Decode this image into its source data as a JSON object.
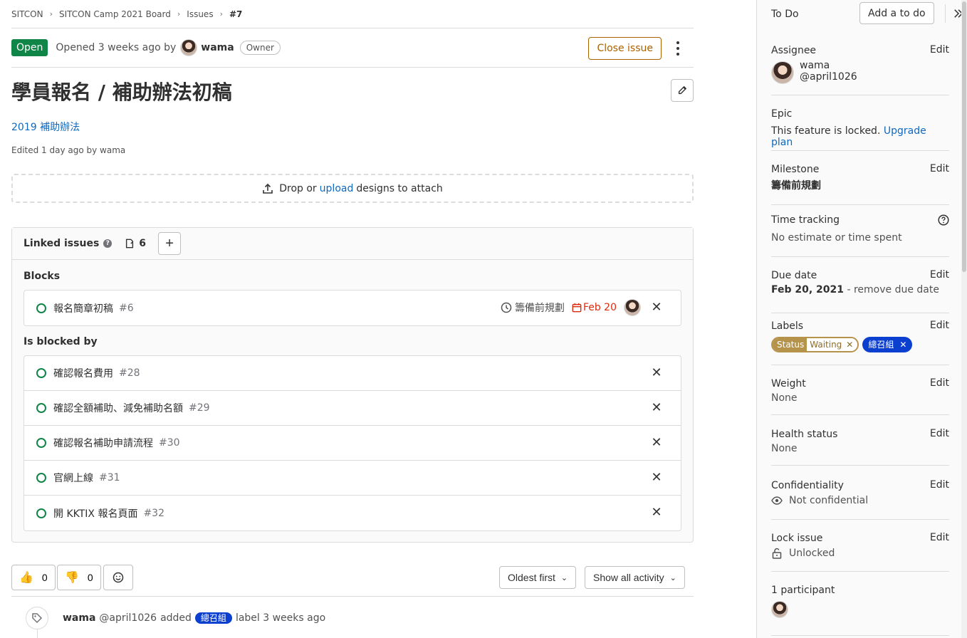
{
  "breadcrumb": [
    "SITCON",
    "SITCON Camp 2021 Board",
    "Issues",
    "#7"
  ],
  "issue": {
    "status": "Open",
    "opened_text": "Opened 3 weeks ago by",
    "author": "wama",
    "author_role": "Owner",
    "close_label": "Close issue",
    "title": "學員報名 / 補助辦法初稿",
    "description_link": "2019 補助辦法",
    "edited_text": "Edited 1 day ago by wama"
  },
  "design": {
    "pre": "Drop or",
    "link": "upload",
    "post": "designs to attach"
  },
  "linked": {
    "title": "Linked issues",
    "count": "6",
    "blocks_title": "Blocks",
    "blocks": [
      {
        "title": "報名簡章初稿",
        "ref": "#6",
        "milestone": "籌備前規劃",
        "due": "Feb 20"
      }
    ],
    "blocked_by_title": "Is blocked by",
    "blocked_by": [
      {
        "title": "確認報名費用",
        "ref": "#28"
      },
      {
        "title": "確認全額補助、減免補助名額",
        "ref": "#29"
      },
      {
        "title": "確認報名補助申請流程",
        "ref": "#30"
      },
      {
        "title": "官網上線",
        "ref": "#31"
      },
      {
        "title": "開 KKTIX 報名頁面",
        "ref": "#32"
      }
    ]
  },
  "awards": {
    "thumbs_up": "0",
    "thumbs_down": "0"
  },
  "sort": {
    "order": "Oldest first",
    "filter": "Show all activity"
  },
  "activity": {
    "author": "wama",
    "handle": "@april1026",
    "action": "added",
    "label": "總召組",
    "suffix": "label 3 weeks ago"
  },
  "sidebar": {
    "todo_title": "To Do",
    "todo_button": "Add a to do",
    "edit_label": "Edit",
    "assignee": {
      "title": "Assignee",
      "name": "wama",
      "handle": "@april1026"
    },
    "epic": {
      "title": "Epic",
      "text": "This feature is locked.",
      "link": "Upgrade plan"
    },
    "milestone": {
      "title": "Milestone",
      "value": "籌備前規劃"
    },
    "time_tracking": {
      "title": "Time tracking",
      "value": "No estimate or time spent"
    },
    "due_date": {
      "title": "Due date",
      "value": "Feb 20, 2021",
      "remove": "- remove due date"
    },
    "labels": {
      "title": "Labels",
      "scoped_key": "Status",
      "scoped_value": "Waiting",
      "second": "總召組"
    },
    "weight": {
      "title": "Weight",
      "value": "None"
    },
    "health": {
      "title": "Health status",
      "value": "None"
    },
    "confidentiality": {
      "title": "Confidentiality",
      "value": "Not confidential"
    },
    "lock": {
      "title": "Lock issue",
      "value": "Unlocked"
    },
    "participants": {
      "title": "1 participant"
    }
  },
  "colors": {
    "open": "#108548",
    "link": "#1068bf",
    "close": "#ab6100",
    "due": "#dd2b0e",
    "label_blue": "#0b3fd0",
    "label_gold": "#b5934a"
  }
}
